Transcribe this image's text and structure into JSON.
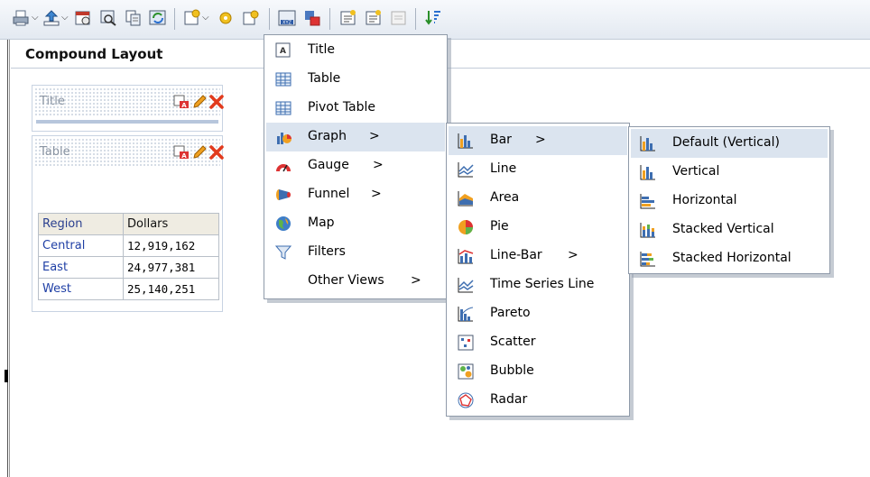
{
  "panel": {
    "title": "Compound Layout"
  },
  "views": {
    "title_view": {
      "label": "Title"
    },
    "table_view": {
      "label": "Table"
    }
  },
  "table": {
    "headers": [
      "Region",
      "Dollars"
    ],
    "rows": [
      {
        "region": "Central",
        "dollars": "12,919,162"
      },
      {
        "region": "East",
        "dollars": "24,977,381"
      },
      {
        "region": "West",
        "dollars": "25,140,251"
      }
    ]
  },
  "menu_new_view": {
    "items": [
      {
        "label": "Title",
        "icon": "title-view-icon"
      },
      {
        "label": "Table",
        "icon": "table-view-icon"
      },
      {
        "label": "Pivot Table",
        "icon": "pivot-table-icon"
      },
      {
        "label": "Graph",
        "icon": "graph-icon",
        "arrow": ">"
      },
      {
        "label": "Gauge",
        "icon": "gauge-icon",
        "arrow": ">"
      },
      {
        "label": "Funnel",
        "icon": "funnel-icon",
        "arrow": ">"
      },
      {
        "label": "Map",
        "icon": "map-icon"
      },
      {
        "label": "Filters",
        "icon": "filters-icon"
      },
      {
        "label": "Other Views",
        "icon": "",
        "arrow": ">"
      }
    ]
  },
  "menu_graph": {
    "items": [
      {
        "label": "Bar",
        "icon": "bar-chart-icon",
        "arrow": ">"
      },
      {
        "label": "Line",
        "icon": "line-chart-icon"
      },
      {
        "label": "Area",
        "icon": "area-chart-icon"
      },
      {
        "label": "Pie",
        "icon": "pie-chart-icon"
      },
      {
        "label": "Line-Bar",
        "icon": "line-bar-chart-icon",
        "arrow": ">"
      },
      {
        "label": "Time Series Line",
        "icon": "time-series-icon"
      },
      {
        "label": "Pareto",
        "icon": "pareto-icon"
      },
      {
        "label": "Scatter",
        "icon": "scatter-icon"
      },
      {
        "label": "Bubble",
        "icon": "bubble-icon"
      },
      {
        "label": "Radar",
        "icon": "radar-icon"
      }
    ]
  },
  "menu_bar": {
    "items": [
      {
        "label": "Default (Vertical)",
        "icon": "bar-vertical-icon"
      },
      {
        "label": "Vertical",
        "icon": "bar-vertical-icon"
      },
      {
        "label": "Horizontal",
        "icon": "bar-horizontal-icon"
      },
      {
        "label": "Stacked Vertical",
        "icon": "stacked-vertical-icon"
      },
      {
        "label": "Stacked Horizontal",
        "icon": "stacked-horizontal-icon"
      }
    ]
  },
  "colors": {
    "accent": "#1f3fa5",
    "menu_highlight": "#dbe4ef",
    "delete": "#e23a1c"
  }
}
